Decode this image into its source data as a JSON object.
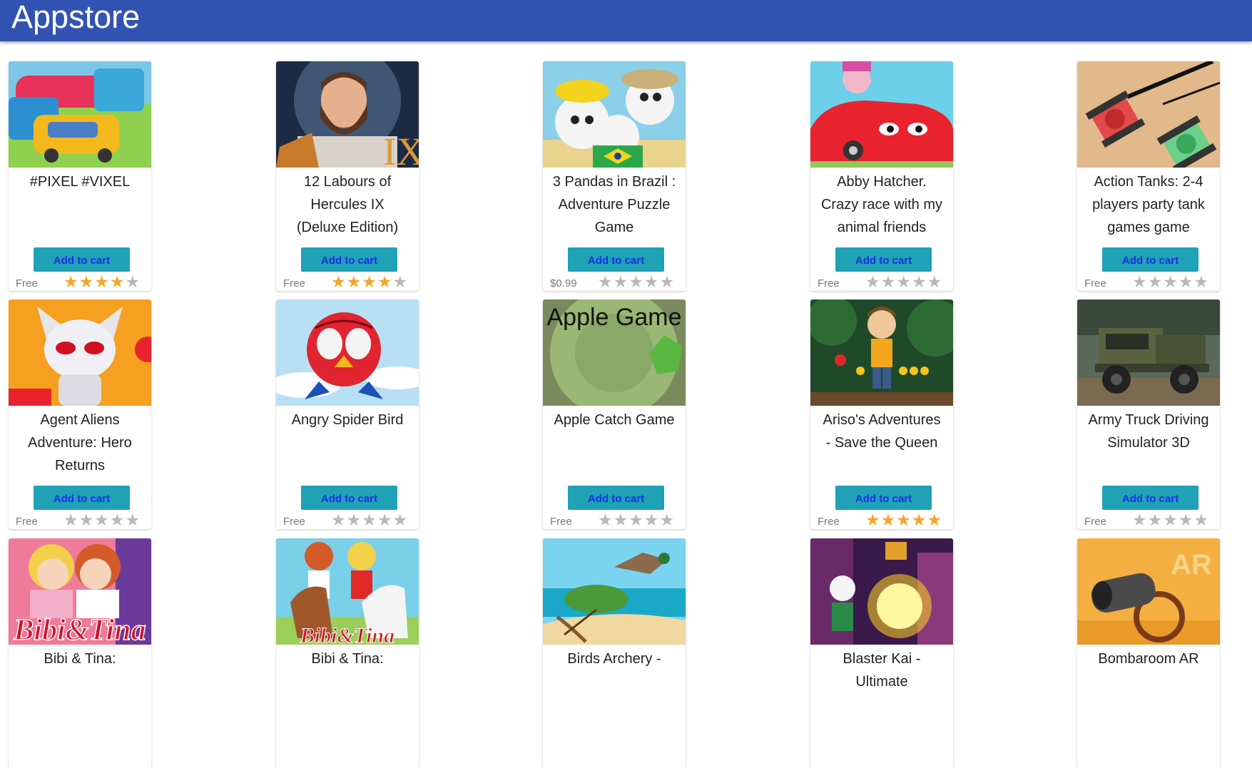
{
  "header": {
    "title": "Appstore"
  },
  "cart_label": "Add to cart",
  "colors": {
    "header": "#3353b2",
    "button": "#1fa1b6",
    "button_text": "#1a2fe6",
    "star_on": "#f4a629",
    "star_off": "#b8b8b8"
  },
  "apps": [
    {
      "name": "#PIXEL #VIXEL",
      "price": "Free",
      "rating": 4
    },
    {
      "name": "12 Labours of Hercules IX (Deluxe Edition)",
      "price": "Free",
      "rating": 4
    },
    {
      "name": "3 Pandas in Brazil : Adventure Puzzle Game",
      "price": "$0.99",
      "rating": 0
    },
    {
      "name": "Abby Hatcher. Crazy race with my animal friends",
      "price": "Free",
      "rating": 0
    },
    {
      "name": "Action Tanks: 2-4 players party tank games game",
      "price": "Free",
      "rating": 0
    },
    {
      "name": "Agent Aliens Adventure: Hero Returns",
      "price": "Free",
      "rating": 0
    },
    {
      "name": "Angry Spider Bird",
      "price": "Free",
      "rating": 0
    },
    {
      "name": "Apple Catch Game",
      "price": "Free",
      "rating": 0,
      "thumb_text": "Apple Game"
    },
    {
      "name": "Ariso's Adventures - Save the Queen",
      "price": "Free",
      "rating": 5
    },
    {
      "name": "Army Truck Driving Simulator 3D",
      "price": "Free",
      "rating": 0
    },
    {
      "name": "Bibi & Tina:",
      "thumb_text": "Bibi&Tina"
    },
    {
      "name": "Bibi & Tina:",
      "thumb_text": "Bibi&Tina"
    },
    {
      "name": "Birds Archery -"
    },
    {
      "name": "Blaster Kai - Ultimate"
    },
    {
      "name": "Bombaroom AR",
      "thumb_text": "AR"
    }
  ]
}
